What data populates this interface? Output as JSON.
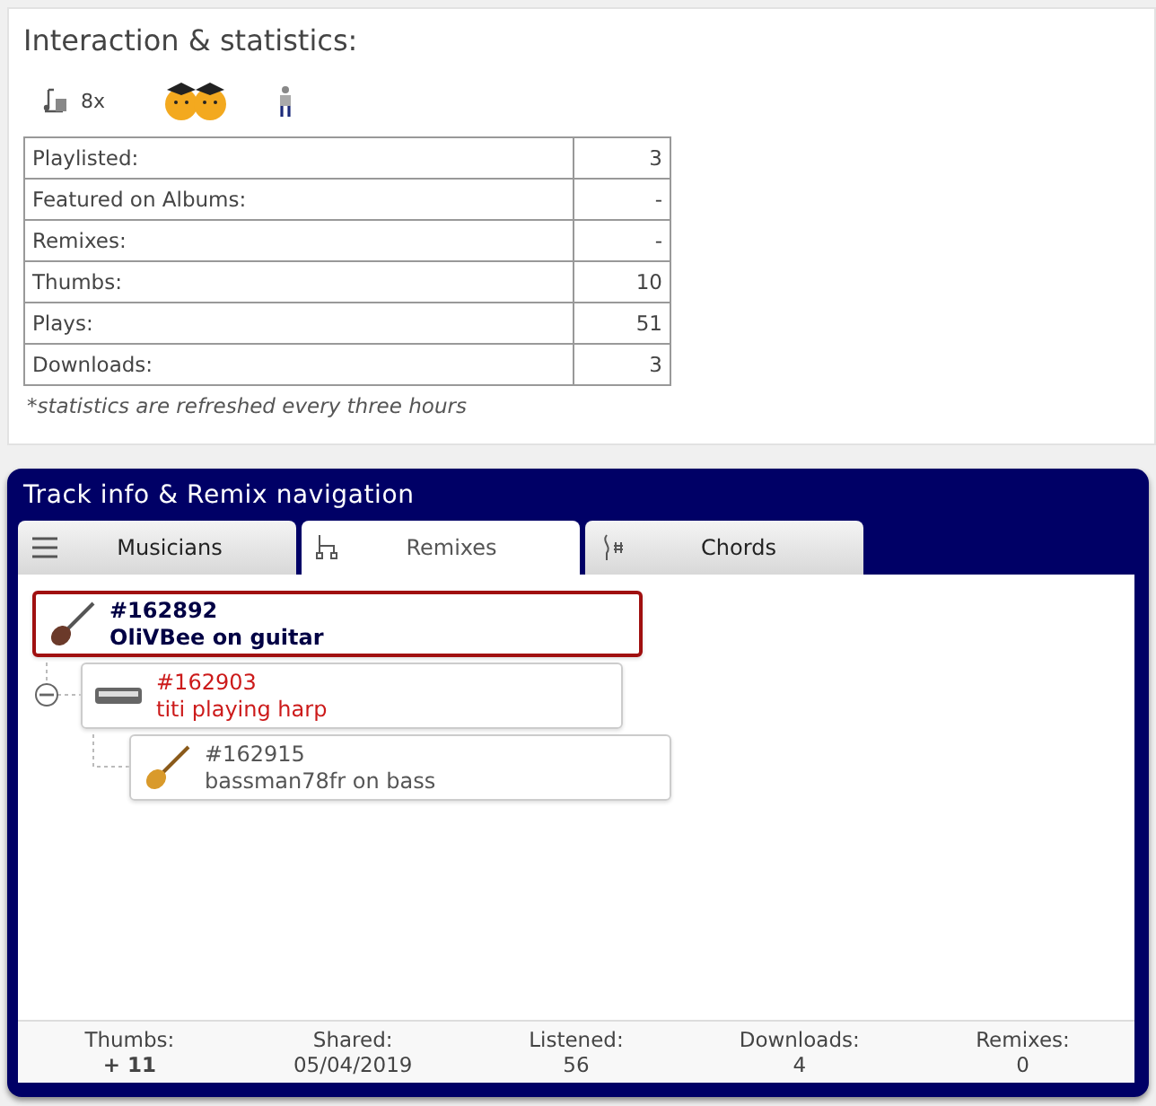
{
  "stats_panel": {
    "title": "Interaction & statistics:",
    "thumbs_count": "8x",
    "rows": [
      {
        "label": "Playlisted:",
        "value": "3"
      },
      {
        "label": "Featured on Albums:",
        "value": "-"
      },
      {
        "label": "Remixes:",
        "value": "-"
      },
      {
        "label": "Thumbs:",
        "value": "10"
      },
      {
        "label": "Plays:",
        "value": "51"
      },
      {
        "label": "Downloads:",
        "value": "3"
      }
    ],
    "note": "*statistics are refreshed every three hours"
  },
  "track_panel": {
    "title": "Track info & Remix navigation",
    "tabs": [
      {
        "label": "Musicians",
        "selected": false
      },
      {
        "label": "Remixes",
        "selected": true
      },
      {
        "label": "Chords",
        "selected": false
      }
    ],
    "tree": [
      {
        "id": "#162892",
        "title": "OliVBee on guitar",
        "kind": "current",
        "children": [
          {
            "id": "#162903",
            "title": "titi playing harp",
            "kind": "highlighted",
            "children": [
              {
                "id": "#162915",
                "title": "bassman78fr on bass",
                "kind": "normal"
              }
            ]
          }
        ]
      }
    ],
    "footer": [
      {
        "label": "Thumbs:",
        "value": "+ 11",
        "emphasized": true
      },
      {
        "label": "Shared:",
        "value": "05/04/2019",
        "emphasized": false
      },
      {
        "label": "Listened:",
        "value": "56",
        "emphasized": false
      },
      {
        "label": "Downloads:",
        "value": "4",
        "emphasized": false
      },
      {
        "label": "Remixes:",
        "value": "0",
        "emphasized": false
      }
    ]
  }
}
